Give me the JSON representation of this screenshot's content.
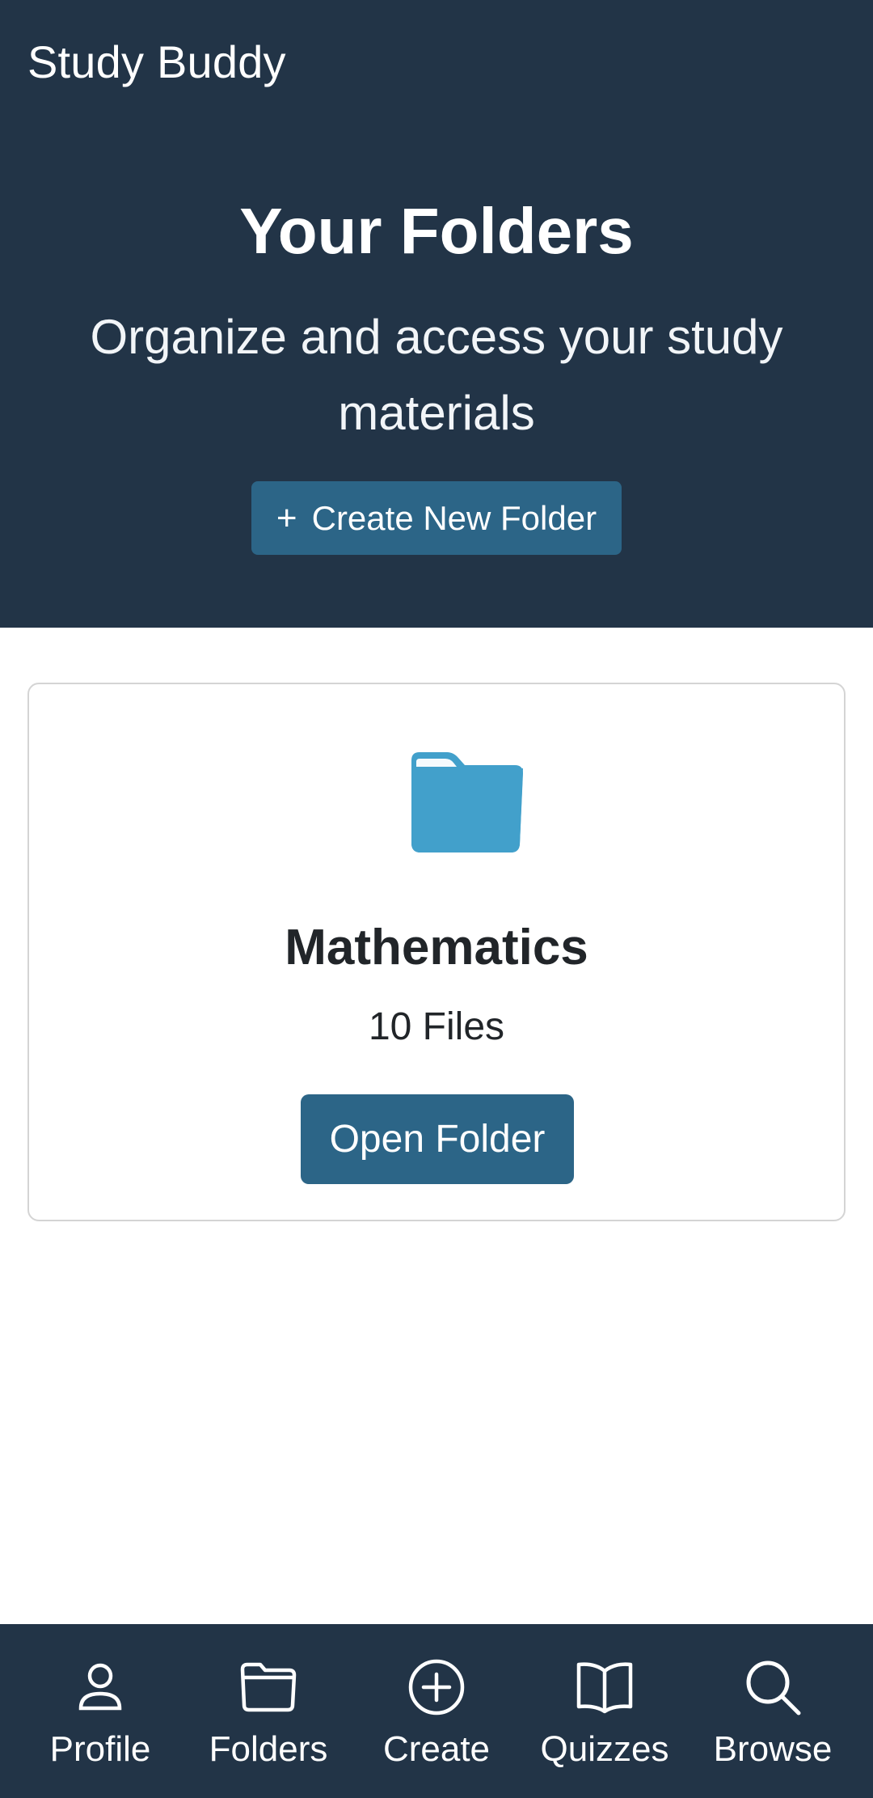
{
  "colors": {
    "hero_bg": "#223447",
    "button_bg": "#2c6587",
    "folder_icon": "#42a0cb"
  },
  "header": {
    "app_title": "Study Buddy",
    "page_title": "Your Folders",
    "subtitle": "Organize and access your study materials",
    "create_button_label": "Create New Folder",
    "create_button_icon": "plus-icon"
  },
  "folders": [
    {
      "name": "Mathematics",
      "file_count": "10 Files",
      "icon": "folder-icon",
      "open_label": "Open Folder"
    }
  ],
  "bottom_nav": [
    {
      "label": "Profile",
      "icon": "person-icon"
    },
    {
      "label": "Folders",
      "icon": "folder-icon"
    },
    {
      "label": "Create",
      "icon": "plus-circle-icon"
    },
    {
      "label": "Quizzes",
      "icon": "book-icon"
    },
    {
      "label": "Browse",
      "icon": "search-icon"
    }
  ]
}
